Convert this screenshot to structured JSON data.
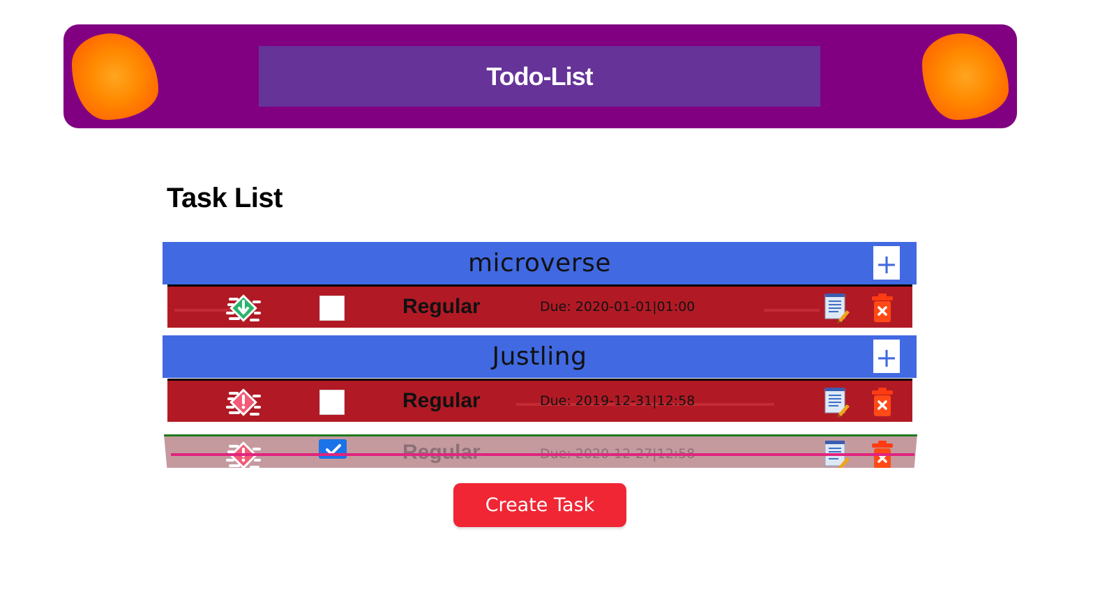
{
  "header": {
    "title": "Todo-List"
  },
  "section_title": "Task List",
  "projects": [
    {
      "name": "microverse",
      "add_label": "+",
      "tasks": [
        {
          "priority": "low",
          "checked": false,
          "title": "Regular",
          "due": "Due: 2020-01-01|01:00"
        }
      ]
    },
    {
      "name": "Justling",
      "add_label": "+",
      "tasks": [
        {
          "priority": "high",
          "checked": false,
          "title": "Regular",
          "due": "Due: 2019-12-31|12:58"
        },
        {
          "priority": "high",
          "checked": true,
          "title": "Regular",
          "due": "Due: 2020-12-27|12:58"
        }
      ]
    }
  ],
  "create_button": "Create Task",
  "colors": {
    "header_bg": "#810081",
    "title_box": "#663399",
    "project_bar": "#4169e1",
    "task_row": "#b11a25",
    "completed_row": "#c49a9e",
    "create_button": "#f02634"
  }
}
